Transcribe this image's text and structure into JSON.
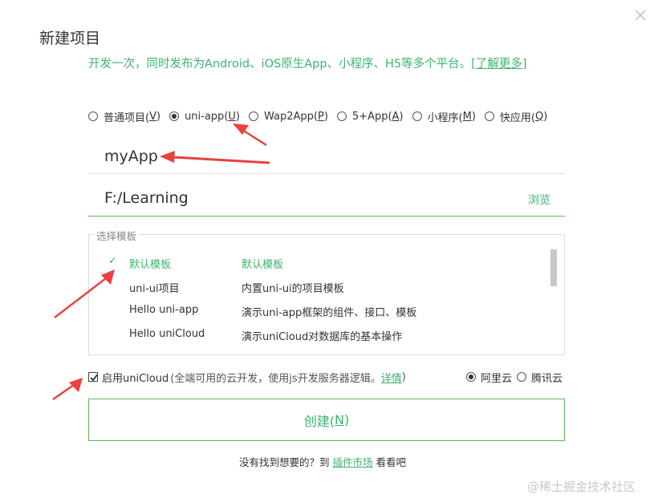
{
  "dialog": {
    "title": "新建项目",
    "subtitle": "开发一次，同时发布为Android、iOS原生App、小程序、H5等多个平台。",
    "learn_more": "[了解更多]"
  },
  "project_types": [
    {
      "label": "普通项目(",
      "key": "V",
      "end": ")",
      "selected": false
    },
    {
      "label": "uni-app(",
      "key": "U",
      "end": ")",
      "selected": true
    },
    {
      "label": "Wap2App(",
      "key": "P",
      "end": ")",
      "selected": false
    },
    {
      "label": "5+App(",
      "key": "A",
      "end": ")",
      "selected": false
    },
    {
      "label": "小程序(",
      "key": "M",
      "end": ")",
      "selected": false
    },
    {
      "label": "快应用(",
      "key": "Q",
      "end": ")",
      "selected": false
    }
  ],
  "project_name": {
    "value": "myApp"
  },
  "location": {
    "value": "F:/Learning",
    "browse_label": "浏览"
  },
  "templates": {
    "legend": "选择模板",
    "selected_mark": "✓",
    "items": [
      {
        "name": "默认模板",
        "desc": "默认模板",
        "selected": true
      },
      {
        "name": "uni-ui项目",
        "desc": "内置uni-ui的项目模板",
        "selected": false
      },
      {
        "name": "Hello uni-app",
        "desc": "演示uni-app框架的组件、接口、模板",
        "selected": false
      },
      {
        "name": "Hello uniCloud",
        "desc": "演示uniCloud对数据库的基本操作",
        "selected": false
      }
    ]
  },
  "unicloud": {
    "checked": true,
    "label": "启用uniCloud",
    "desc": "(全端可用的云开发，使用js开发服务器逻辑。",
    "details_link": "详情",
    "desc_end": ")",
    "providers": [
      {
        "label": "阿里云",
        "selected": true
      },
      {
        "label": "腾讯云",
        "selected": false
      }
    ]
  },
  "create_button": {
    "label": "创建(",
    "key": "N",
    "end": ")"
  },
  "footer": {
    "prefix": "没有找到想要的？到 ",
    "link": "插件市场",
    "suffix": " 看看吧"
  },
  "watermark": "@稀土掘金技术社区",
  "colors": {
    "accent": "#3cb371",
    "annotation_arrow": "#e8413e"
  }
}
